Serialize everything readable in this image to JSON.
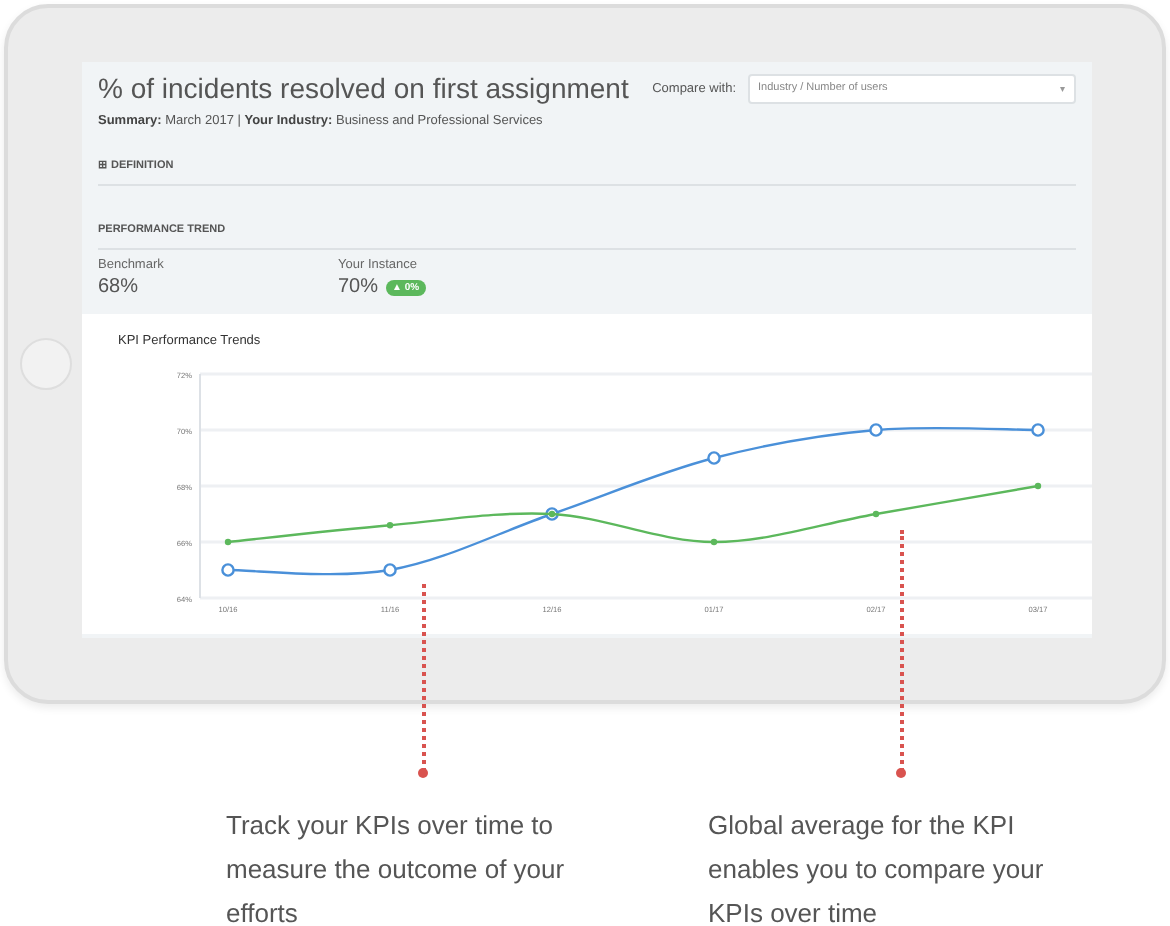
{
  "header": {
    "title": "% of incidents resolved on first assignment",
    "compare_label": "Compare with:",
    "compare_select": {
      "value": "Industry / Number of users",
      "caret": "▾"
    }
  },
  "summary": {
    "text": "**Summary:** March 2017 | **Your Industry:** Business and Professional Services"
  },
  "definition": {
    "icon": "⊞",
    "label": "DEFINITION",
    "expanded": false
  },
  "performance_trend": {
    "heading": "PERFORMANCE TREND",
    "metrics": [
      {
        "label": "Benchmark",
        "value": "68%"
      },
      {
        "label": "Your Instance",
        "value": "70%",
        "badge": "▲ 0%"
      }
    ]
  },
  "chart": {
    "title": "KPI Performance Trends",
    "chart_data": {
      "type": "line",
      "grid": true,
      "categories": [
        "10/16",
        "11/16",
        "12/16",
        "01/17",
        "02/17",
        "03/17"
      ],
      "yticks": [
        {
          "value": 64,
          "label": "64%"
        },
        {
          "value": 66,
          "label": "66%"
        },
        {
          "value": 68,
          "label": "68%"
        },
        {
          "value": 70,
          "label": "70%"
        },
        {
          "value": 72,
          "label": "72%"
        }
      ],
      "ylim": [
        64,
        72
      ],
      "series": [
        {
          "color": "#4a90d9",
          "marker": "circle",
          "values": [
            65,
            65,
            67,
            69,
            70,
            70
          ]
        },
        {
          "color": "#5cb85c",
          "marker": "dot",
          "values": [
            66,
            66.6,
            67,
            66,
            67,
            68
          ]
        }
      ]
    }
  },
  "annotations": [
    {
      "text": "Track your KPIs over time to measure the outcome of your efforts"
    },
    {
      "text": "Global average for the KPI enables you to compare your KPIs over time"
    }
  ]
}
